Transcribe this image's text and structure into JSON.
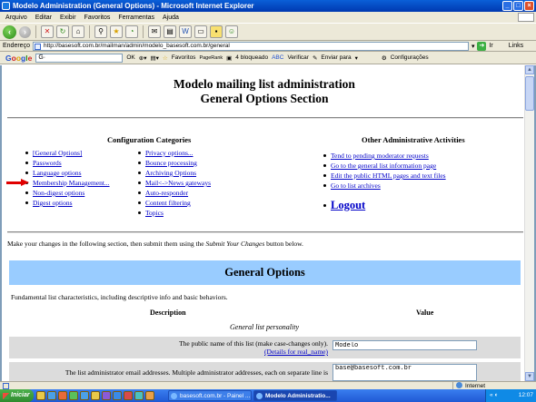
{
  "window": {
    "title": "Modelo Administration (General Options) - Microsoft Internet Explorer",
    "controls": [
      "_",
      "□",
      "×"
    ]
  },
  "menubar": [
    "Arquivo",
    "Editar",
    "Exibir",
    "Favoritos",
    "Ferramentas",
    "Ajuda"
  ],
  "addressbar": {
    "label": "Endereço",
    "url": "http://basesoft.com.br/mailman/admin/modelo_basesoft.com.br/general",
    "go_label": "Ir",
    "links_label": "Links"
  },
  "googlebar": {
    "logo": "Google",
    "search_value": "G·",
    "ok_label": "OK",
    "favoritos": "Favoritos",
    "pagerank": "PageRank",
    "blocked": "4 bloqueado",
    "verificar": "Verificar",
    "enviar": "Enviar para",
    "config": "Configurações"
  },
  "page": {
    "title_line1": "Modelo mailing list administration",
    "title_line2": "General Options Section",
    "config_heading": "Configuration Categories",
    "config_col1": [
      "[General Options]",
      "Passwords",
      "Language options",
      "Membership Management...",
      "Non-digest options",
      "Digest options"
    ],
    "config_col2": [
      "Privacy options...",
      "Bounce processing",
      "Archiving Options",
      "Mail<->News gateways",
      "Auto-responder",
      "Content filtering",
      "Topics"
    ],
    "other_heading": "Other Administrative Activities",
    "other_links": [
      "Tend to pending moderator requests",
      "Go to the general list information page",
      "Edit the public HTML pages and text files",
      "Go to list archives"
    ],
    "logout": "Logout",
    "instructions_pre": "Make your changes in the following section, then submit them using the ",
    "instructions_em": "Submit Your Changes",
    "instructions_post": " button below.",
    "section_title": "General Options",
    "fundamental": "Fundamental list characteristics, including descriptive info and basic behaviors.",
    "col_description": "Description",
    "col_value": "Value",
    "group_title": "General list personality",
    "rows": [
      {
        "desc": "The public name of this list (make case-changes only).",
        "details": "(Details for real_name)",
        "value": "Modelo"
      },
      {
        "desc": "The list administrator email addresses. Multiple administrator addresses, each on separate line is",
        "value": "base@basesoft.com.br"
      }
    ]
  },
  "statusbar": {
    "zone": "Internet"
  },
  "taskbar": {
    "start": "Iniciar",
    "tasks": [
      "basesoft.com.br - Painel ...",
      "Modelo Administratio..."
    ],
    "clock": "12:07"
  },
  "colors": {
    "link": "#0000c8",
    "section_bg": "#99ccff",
    "row_bg": "#dcdcdc",
    "arrow": "#e00000"
  }
}
